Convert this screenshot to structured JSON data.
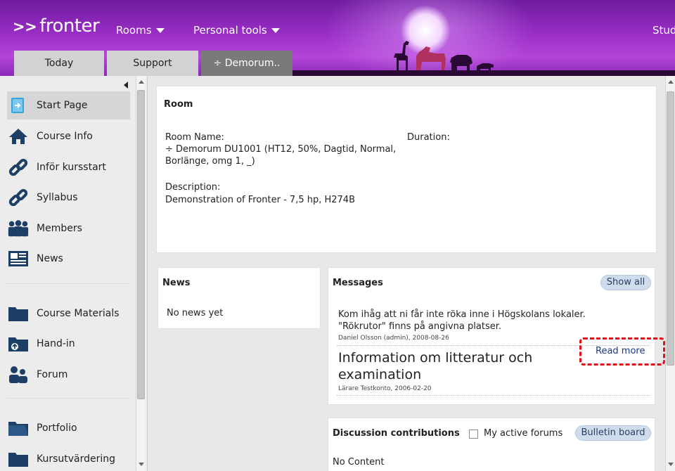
{
  "header": {
    "logo_arrows": ">>",
    "logo_text": "fronter",
    "menu": {
      "rooms": "Rooms",
      "personal_tools": "Personal tools"
    },
    "right_link": "Stud",
    "tabs": [
      "Today",
      "Support",
      "÷ Demorum.."
    ],
    "brand_color": "#9a2ec6"
  },
  "sidebar": {
    "items": [
      {
        "label": "Start Page",
        "icon": "start-page-icon"
      },
      {
        "label": "Course Info",
        "icon": "home-icon"
      },
      {
        "label": "Inför kursstart",
        "icon": "link-icon"
      },
      {
        "label": "Syllabus",
        "icon": "link-icon"
      },
      {
        "label": "Members",
        "icon": "members-icon"
      },
      {
        "label": "News",
        "icon": "news-icon"
      },
      {
        "label": "Course Materials",
        "icon": "folder-icon"
      },
      {
        "label": "Hand-in",
        "icon": "hand-in-folder-icon"
      },
      {
        "label": "Forum",
        "icon": "forum-icon"
      },
      {
        "label": "Portfolio",
        "icon": "portfolio-folder-icon"
      },
      {
        "label": "Kursutvärdering",
        "icon": "folder-icon"
      }
    ]
  },
  "room": {
    "title": "Room",
    "name_label": "Room Name:",
    "name_value_line1": "÷ Demorum DU1001 (HT12, 50%, Dagtid, Normal,",
    "name_value_line2": "Borlänge, omg 1, _)",
    "duration_label": "Duration:",
    "description_label": "Description:",
    "description_value": "Demonstration of Fronter - 7,5 hp, H274B"
  },
  "news": {
    "title": "News",
    "empty_text": "No news yet"
  },
  "messages": {
    "title": "Messages",
    "show_all": "Show all",
    "items": [
      {
        "text_line1": "Kom ihåg att ni får inte röka inne i Högskolans lokaler.",
        "text_line2": "\"Rökrutor\" finns på angivna platser.",
        "meta": "Daniel Olsson (admin),  2008-08-26"
      },
      {
        "title_line1": "Information om litteratur och",
        "title_line2": "examination",
        "meta": "Lärare Testkonto,  2006-02-20",
        "read_more": "Read more"
      }
    ]
  },
  "discussions": {
    "title": "Discussion contributions",
    "checkbox_label": "My active forums",
    "bulletin_button": "Bulletin board",
    "empty_text": "No Content"
  }
}
